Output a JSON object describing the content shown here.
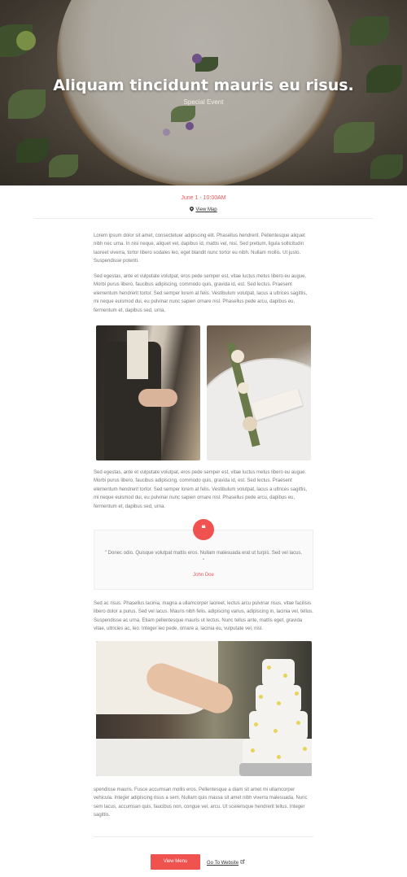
{
  "hero": {
    "title": "Aliquam tincidunt mauris eu risus.",
    "subtitle": "Special Event"
  },
  "event": {
    "date": "June 1 - 10:00AM",
    "map_label": "View Map",
    "map_icon": "map-pin-icon"
  },
  "content": {
    "para1": "Lorem ipsum dolor sit amet, consectetuer adipiscing elit. Phasellus hendrerit. Pellentesque aliquet nibh nec urna. In nisi neque, aliquet vel, dapibus id, mattis vel, nisi. Sed pretium, ligula sollicitudin laoreet viverra, tortor libero sodales leo, eget blandit nunc tortor eu nibh. Nullam mollis. Ut justo. Suspendisse potenti.",
    "para2": "Sed egestas, ante et vulputate volutpat, eros pede semper est, vitae luctus metus libero eu augue. Morbi purus libero, faucibus adipiscing, commodo quis, gravida id, est. Sed lectus. Praesent elementum hendrerit tortor. Sed semper lorem at felis. Vestibulum volutpat, lacus a ultrices sagittis, mi neque euismod dui, eu pulvinar nunc sapien ornare nisl. Phasellus pede arcu, dapibus eu, fermentum et, dapibus sed, urna.",
    "para3": "Sed egestas, ante et vulputate volutpat, eros pede semper est, vitae luctus metus libero eu augue. Morbi purus libero, faucibus adipiscing, commodo quis, gravida id, est. Sed lectus. Praesent elementum hendrerit tortor. Sed semper lorem at felis. Vestibulum volutpat, lacus a ultrices sagittis, mi neque euismod dui, eu pulvinar nunc sapien ornare nisl. Phasellus pede arcu, dapibus eu, fermentum et, dapibus sed, urna.",
    "para4": "Sed ac risus. Phasellus lacinia, magna a ullamcorper laoreet, lectus arcu pulvinar risus, vitae facilisis libero dolor a purus. Sed vel lacus. Mauris nibh felis, adipiscing varius, adipiscing in, lacinia vel, tellus. Suspendisse ac urna. Etiam pellentesque mauris ut lectus. Nunc tellus ante, mattis eget, gravida vitae, ultricies ac, leo. Integer leo pede, ornare a, lacinia eu, vulputate vel, nisl.",
    "para5": "spendisse mauris. Fusce accumsan mollis eros. Pellentesque a diam sit amet mi ullamcorper vehicula. Integer adipiscing risus a sem. Nullam quis massa sit amet nibh viverra malesuada. Nunc sem lacus, accumsan quis, faucibus non, congue vel, arcu. Ut scelerisque hendrerit tellus. Integer sagittis."
  },
  "quote": {
    "icon": "quote-icon",
    "mark": "❝",
    "text": "\" Donec odio. Quisque volutpat mattis eros. Nullam malesuada erat ut turpis. Sed vel lacus. \"",
    "author": "John Doe"
  },
  "footer": {
    "menu_button": "View Menu",
    "website_link": "Go To Website",
    "website_icon": "external-link-icon"
  },
  "colors": {
    "accent": "#f0524f",
    "text": "#777777"
  }
}
